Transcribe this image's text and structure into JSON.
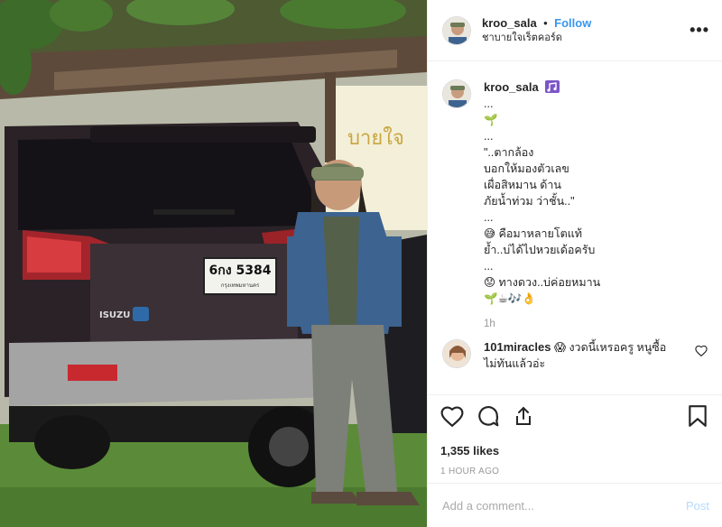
{
  "post": {
    "username": "kroo_sala",
    "separator": "•",
    "follow_label": "Follow",
    "location": "ชาบายใจเร็ตคอร์ด",
    "more_label": "•••"
  },
  "photo": {
    "plate": "6กง 5384",
    "plate_sub": "กรุงเทพมหานคร",
    "badge": "ISUZU",
    "sign_text": "บายใจ"
  },
  "caption": {
    "username": "kroo_sala",
    "lines": [
      "...",
      "🌱",
      "...",
      "\"..ตากล้อง",
      "บอกให้มองตัวเลข",
      "เผื่อสิหมาน ด้าน",
      "ภัยน้ำท่วม ว่าชั้น..\"",
      "...",
      "😅 คือมาหลายโตแท้",
      "ย้ำ..บ่ได้ไปหวยเด้อครับ",
      "...",
      "😟 ทางดวง..บ่ค่อยหมาน",
      "🌱☕🎶👌"
    ],
    "time": "1h"
  },
  "comment": {
    "username": "101miracles",
    "text": "😱 งวดนี้เหรอครู หนูซื้อไม่ทันแล้วอ่ะ"
  },
  "actions": {
    "likes": "1,355 likes",
    "time": "1 HOUR AGO"
  },
  "add_comment": {
    "placeholder": "Add a comment...",
    "post_label": "Post"
  },
  "colors": {
    "accent": "#3897f0",
    "post_disabled": "#b3dbff",
    "divider": "#efefef"
  },
  "icons": [
    "like-icon",
    "comment-icon",
    "share-icon",
    "save-icon",
    "music-icon",
    "heart-small-icon"
  ]
}
